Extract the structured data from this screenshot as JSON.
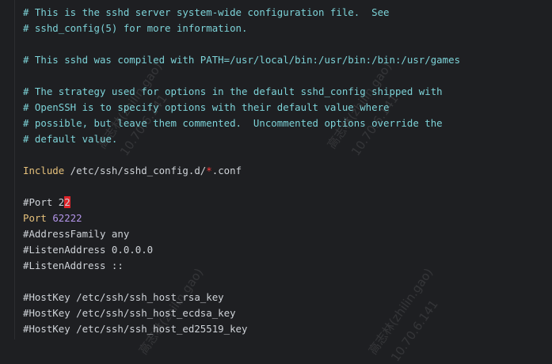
{
  "editor": {
    "lines": {
      "l1": "# This is the sshd server system-wide configuration file.  See",
      "l2": "# sshd_config(5) for more information.",
      "l3": "# This sshd was compiled with PATH=/usr/local/bin:/usr/bin:/bin:/usr/games",
      "l4": "# The strategy used for options in the default sshd_config shipped with",
      "l5": "# OpenSSH is to specify options with their default value where",
      "l6": "# possible, but leave them commented.  Uncommented options override the",
      "l7": "# default value.",
      "include_kw": "Include",
      "include_path": " /etc/ssh/sshd_config.d/",
      "include_star": "*",
      "include_ext": ".conf",
      "port_comment_prefix": "#Port 2",
      "port_comment_cursor": "2",
      "port_kw": "Port",
      "port_value": "62222",
      "address_family": "#AddressFamily any",
      "listen1": "#ListenAddress 0.0.0.0",
      "listen2": "#ListenAddress ::",
      "hostkey_rsa": "#HostKey /etc/ssh/ssh_host_rsa_key",
      "hostkey_ecdsa": "#HostKey /etc/ssh/ssh_host_ecdsa_key",
      "hostkey_ed25519": "#HostKey /etc/ssh/ssh_host_ed25519_key"
    },
    "watermarks": {
      "w1": "高志林(zhilin.gao)",
      "w2": "10.70.6.141"
    }
  }
}
